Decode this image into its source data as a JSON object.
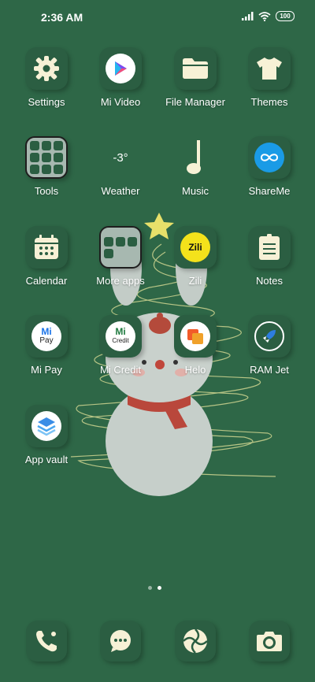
{
  "status": {
    "time": "2:36 AM",
    "battery": "100"
  },
  "colors": {
    "background": "#2e6747",
    "tile": "#2b5e42",
    "icon": "#f7f1d6"
  },
  "apps": [
    {
      "label": "Settings",
      "icon": "gear-icon"
    },
    {
      "label": "Mi Video",
      "icon": "play-icon"
    },
    {
      "label": "File Manager",
      "icon": "folder-icon"
    },
    {
      "label": "Themes",
      "icon": "tshirt-icon"
    },
    {
      "label": "Tools",
      "icon": "tools-folder-icon"
    },
    {
      "label": "Weather",
      "icon": "weather-icon",
      "value": "-3°"
    },
    {
      "label": "Music",
      "icon": "music-note-icon"
    },
    {
      "label": "ShareMe",
      "icon": "infinity-icon"
    },
    {
      "label": "Calendar",
      "icon": "calendar-icon"
    },
    {
      "label": "More apps",
      "icon": "folder-icon"
    },
    {
      "label": "Zili",
      "icon": "zili-icon",
      "icon_text": "Zili"
    },
    {
      "label": "Notes",
      "icon": "notes-icon"
    },
    {
      "label": "Mi Pay",
      "icon": "mi-pay-icon",
      "icon_text": "Pay"
    },
    {
      "label": "Mi Credit",
      "icon": "mi-credit-icon",
      "icon_text": "Credit"
    },
    {
      "label": "Helo",
      "icon": "helo-icon"
    },
    {
      "label": "RAM Jet",
      "icon": "rocket-icon"
    },
    {
      "label": "App vault",
      "icon": "app-vault-icon"
    }
  ],
  "dock": [
    {
      "icon": "phone-icon"
    },
    {
      "icon": "messages-icon"
    },
    {
      "icon": "browser-icon"
    },
    {
      "icon": "camera-icon"
    }
  ],
  "pages": {
    "count": 2,
    "active": 2
  }
}
